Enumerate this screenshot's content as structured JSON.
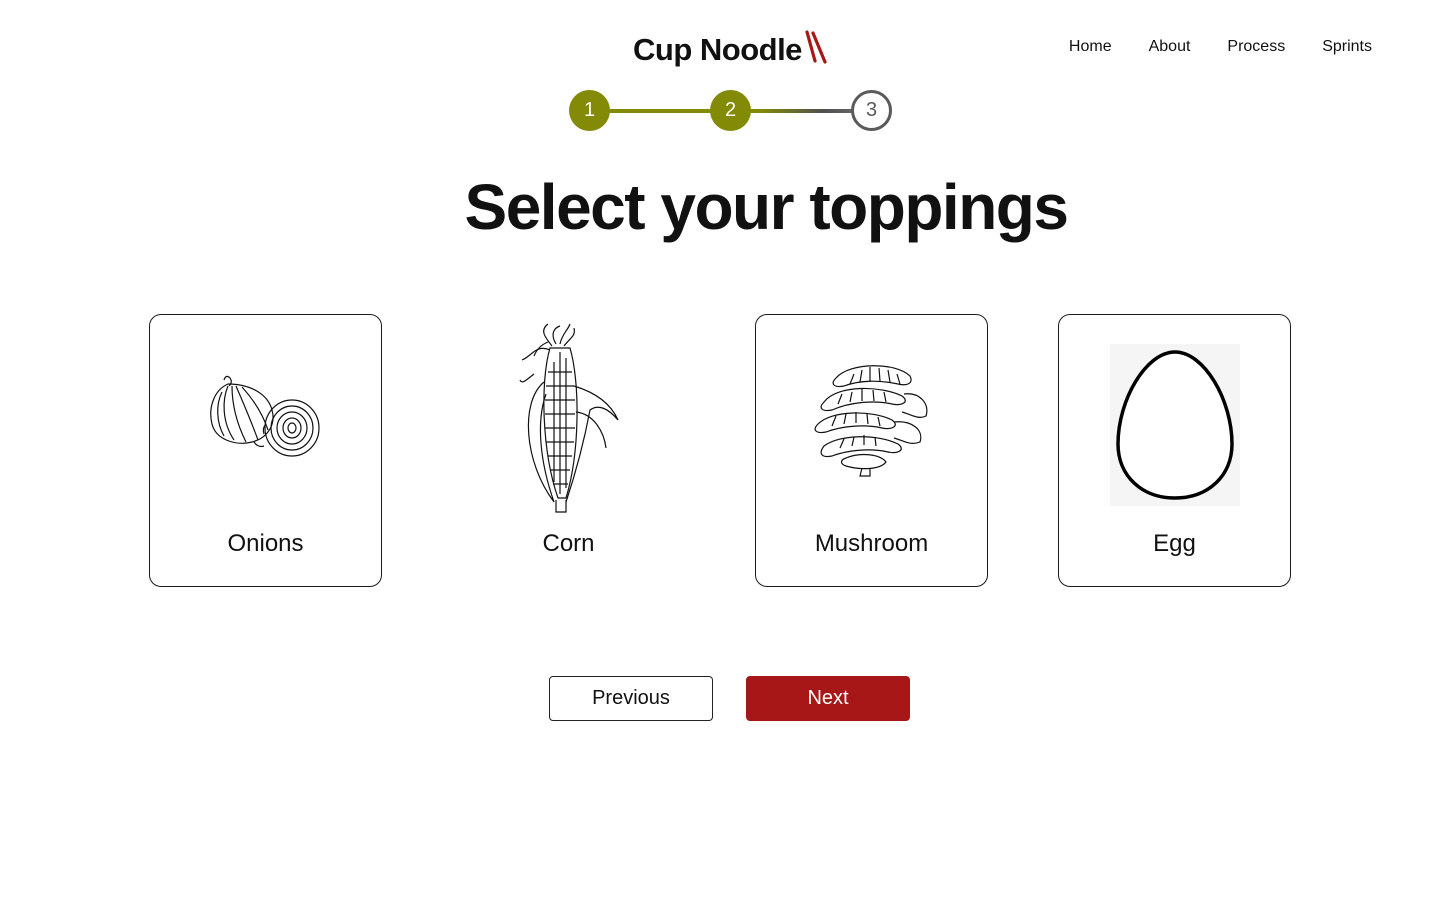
{
  "brand": {
    "name": "Cup Noodle",
    "accent_color": "#a71717",
    "icon": "chopsticks-icon"
  },
  "nav": {
    "items": [
      {
        "label": "Home"
      },
      {
        "label": "About"
      },
      {
        "label": "Process"
      },
      {
        "label": "Sprints"
      }
    ]
  },
  "stepper": {
    "current_step": 2,
    "total_steps": 3,
    "active_color": "#838a06",
    "steps": [
      {
        "number": "1",
        "state": "complete"
      },
      {
        "number": "2",
        "state": "current"
      },
      {
        "number": "3",
        "state": "upcoming"
      }
    ]
  },
  "page": {
    "title": "Select your toppings"
  },
  "toppings": [
    {
      "label": "Onions",
      "icon": "onion-icon",
      "selected": false
    },
    {
      "label": "Corn",
      "icon": "corn-icon",
      "selected": false
    },
    {
      "label": "Mushroom",
      "icon": "mushroom-icon",
      "selected": false
    },
    {
      "label": "Egg",
      "icon": "egg-icon",
      "selected": false
    }
  ],
  "actions": {
    "previous_label": "Previous",
    "next_label": "Next"
  }
}
